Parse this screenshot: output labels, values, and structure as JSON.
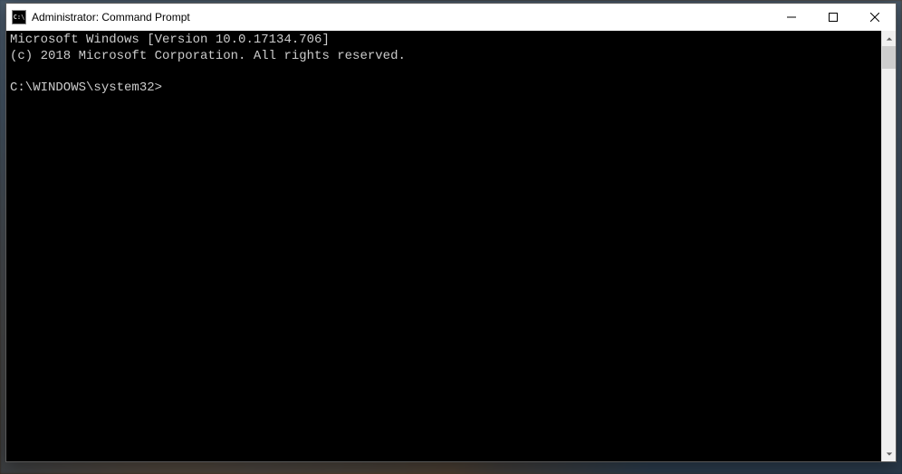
{
  "window": {
    "title": "Administrator: Command Prompt"
  },
  "terminal": {
    "line1": "Microsoft Windows [Version 10.0.17134.706]",
    "line2": "(c) 2018 Microsoft Corporation. All rights reserved.",
    "blank": "",
    "prompt": "C:\\WINDOWS\\system32>"
  }
}
